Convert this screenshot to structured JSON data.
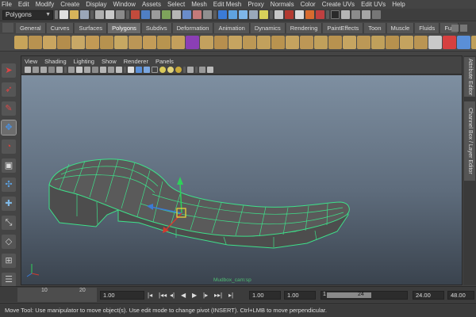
{
  "menu": [
    "File",
    "Edit",
    "Modify",
    "Create",
    "Display",
    "Window",
    "Assets",
    "Select",
    "Mesh",
    "Edit Mesh",
    "Proxy",
    "Normals",
    "Color",
    "Create UVs",
    "Edit UVs",
    "Help"
  ],
  "status_line": {
    "mode": "Polygons"
  },
  "shelf_tabs": [
    "General",
    "Curves",
    "Surfaces",
    "Polygons",
    "Subdivs",
    "Deformation",
    "Animation",
    "Dynamics",
    "Rendering",
    "PaintEffects",
    "Toon",
    "Muscle",
    "Fluids",
    "Fur"
  ],
  "active_shelf_tab": "Polygons",
  "panel_menu": [
    "View",
    "Shading",
    "Lighting",
    "Show",
    "Renderer",
    "Panels"
  ],
  "viewport": {
    "camera_label": "Mudbox_cam:sp"
  },
  "side_tabs": {
    "attribute_editor": "Attribute Editor",
    "channel_box": "Channel Box / Layer Editor"
  },
  "timeline": {
    "ruler_ticks": [
      "10",
      "20"
    ],
    "current_frame": "1.00",
    "range_start": "1.00",
    "playback_start": "1.00",
    "range_bar_start": "1",
    "range_bar_end": "24",
    "range_end": "24.00",
    "playback_end": "48.00"
  },
  "help_line": "Move Tool: Use manipulator to move object(s). Use edit mode to change pivot (INSERT).  Ctrl+LMB to move perpendicular.",
  "colors": {
    "wireframe": "#3ee08a",
    "accent_blue": "#3b7bd6",
    "accent_red": "#d23b2f"
  }
}
